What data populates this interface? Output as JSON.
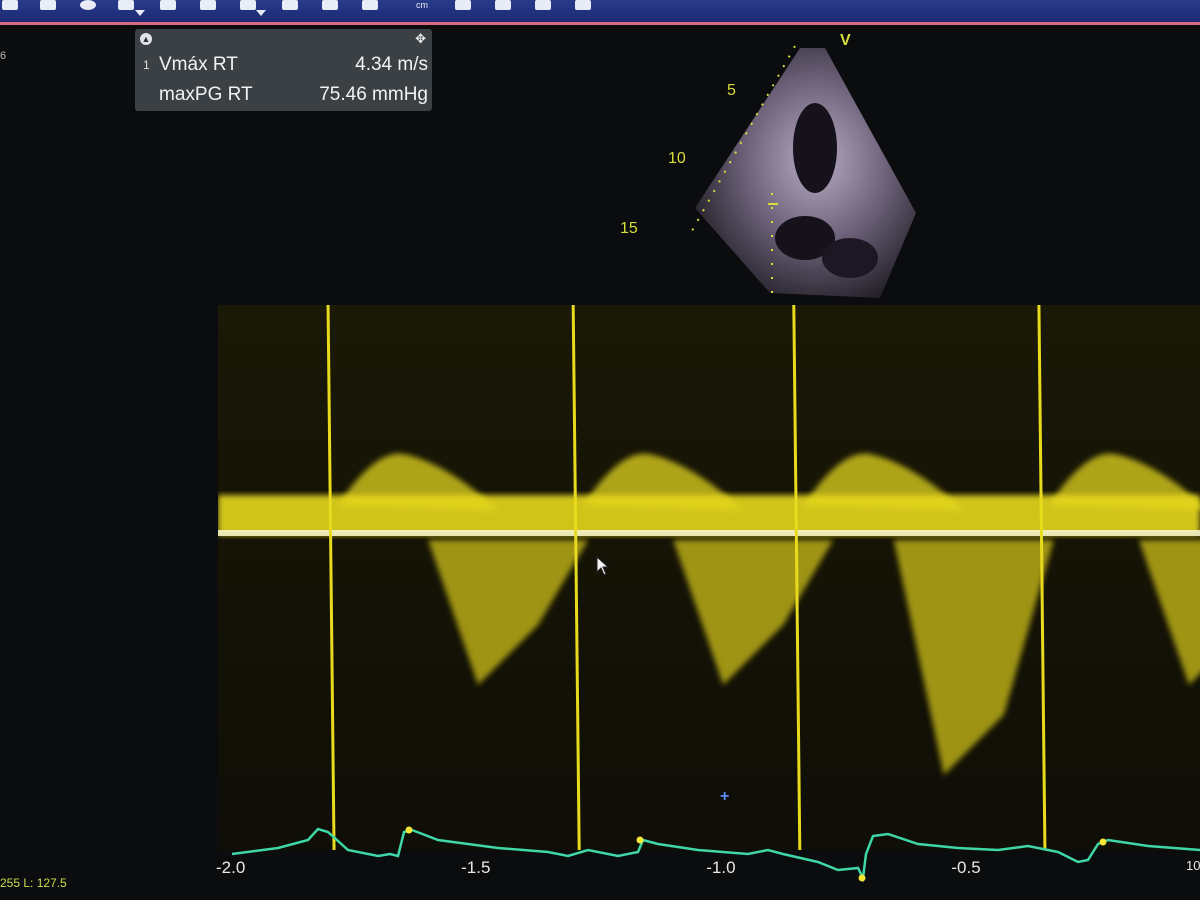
{
  "toolbar": {
    "unit_label": "cm"
  },
  "edge_label": "6",
  "measurement": {
    "index": "1",
    "rows": [
      {
        "label": "Vmáx RT",
        "value": "4.34 m/s"
      },
      {
        "label": "maxPG RT",
        "value": "75.46 mmHg"
      }
    ]
  },
  "echo": {
    "orientation_marker": "V",
    "depth_labels": [
      "5",
      "10",
      "15"
    ]
  },
  "chart_data": {
    "type": "line",
    "x_ticks": [
      "-2.0",
      "-1.5",
      "-1.0",
      "-0.5"
    ],
    "x_tick_values": [
      -2.0,
      -1.5,
      -1.0,
      -0.5
    ],
    "xlim": [
      -2.0,
      -0.05
    ],
    "xlabel": "",
    "ylabel": "",
    "right_edge_label": "10",
    "series": [
      {
        "values": [
          -1.8,
          -1.3,
          -0.85,
          -0.35
        ]
      }
    ],
    "grid": false
  },
  "status": "255 L: 127.5",
  "colors": {
    "doppler": "#e0d21c",
    "ecg": "#3fd7a6",
    "baseline": "#f4f1c2",
    "toolbar": "#1d2b74",
    "accent_pink": "#d86a86"
  },
  "icons": {
    "cursor": "mouse-pointer-icon",
    "move": "move-icon",
    "collapse": "collapse-icon"
  }
}
